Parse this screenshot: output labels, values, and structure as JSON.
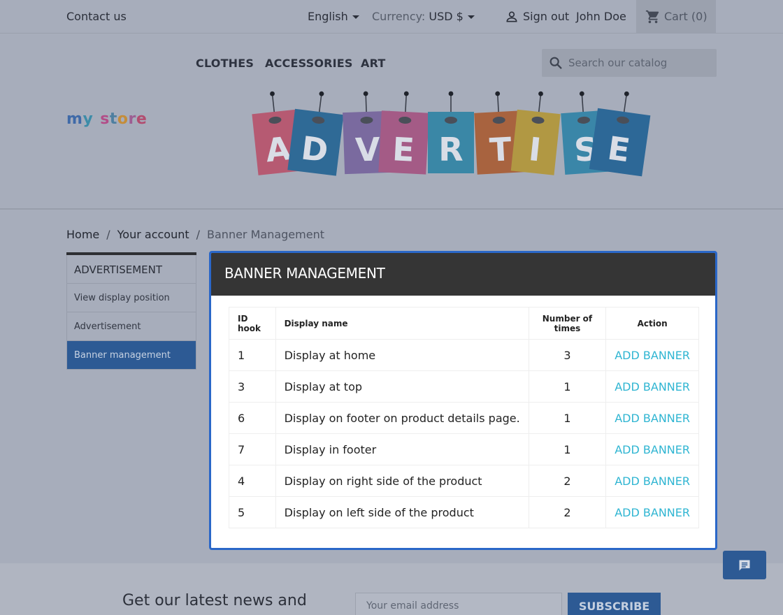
{
  "header": {
    "contact": "Contact us",
    "language": "English",
    "currency_label": "Currency:",
    "currency_value": "USD $",
    "sign_out": "Sign out",
    "user_name": "John Doe",
    "cart": "Cart",
    "cart_count": "(0)"
  },
  "nav": {
    "items": [
      "CLOTHES",
      "ACCESSORIES",
      "ART"
    ]
  },
  "search": {
    "placeholder": "Search our catalog"
  },
  "logo": {
    "text": "my store"
  },
  "banner": {
    "letters": [
      "A",
      "D",
      "V",
      "E",
      "R",
      "T",
      "I",
      "S",
      "E"
    ]
  },
  "breadcrumb": [
    "Home",
    "Your account",
    "Banner Management"
  ],
  "sidebar": {
    "title": "ADVERTISEMENT",
    "items": [
      "View display position",
      "Advertisement",
      "Banner management"
    ]
  },
  "modal": {
    "title": "BANNER MANAGEMENT",
    "columns": [
      "ID hook",
      "Display name",
      "Number of times",
      "Action"
    ],
    "rows": [
      {
        "id": "1",
        "name": "Display at home",
        "count": "3",
        "action": "ADD BANNER"
      },
      {
        "id": "3",
        "name": "Display at top",
        "count": "1",
        "action": "ADD BANNER"
      },
      {
        "id": "6",
        "name": "Display on footer on product details page.",
        "count": "1",
        "action": "ADD BANNER"
      },
      {
        "id": "7",
        "name": "Display in footer",
        "count": "1",
        "action": "ADD BANNER"
      },
      {
        "id": "4",
        "name": "Display on right side of the product",
        "count": "2",
        "action": "ADD BANNER"
      },
      {
        "id": "5",
        "name": "Display on left side of the product",
        "count": "2",
        "action": "ADD BANNER"
      }
    ]
  },
  "footer": {
    "newsletter": "Get our latest news and",
    "email_placeholder": "Your email address",
    "subscribe": "SUBSCRIBE"
  },
  "colors": {
    "overlay": "#a7adbb",
    "modal_border": "#2a67c8",
    "modal_header": "#353535",
    "link": "#2fb5d2",
    "primary_dimmed": "#2d5a94"
  },
  "icons": [
    "user-icon",
    "cart-icon",
    "search-icon",
    "chat-icon",
    "caret-down-icon"
  ]
}
